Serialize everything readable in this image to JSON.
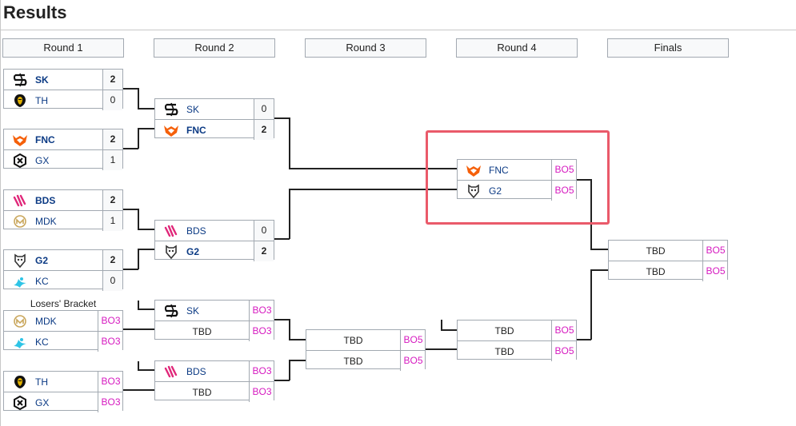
{
  "page": {
    "title": "Results"
  },
  "rounds": [
    "Round 1",
    "Round 2",
    "Round 3",
    "Round 4",
    "Finals"
  ],
  "losers_bracket_label": "Losers' Bracket",
  "colors": {
    "bo_text": "#d61ac0",
    "team_link": "#0b3a84",
    "highlight": "#ea5a6a",
    "header_bg": "#f8f9fa"
  },
  "matches": {
    "r1_m1": {
      "top": {
        "team": "SK",
        "logo": "sk-logo-icon",
        "score": "2",
        "win": true
      },
      "bottom": {
        "team": "TH",
        "logo": "th-logo-icon",
        "score": "0"
      }
    },
    "r1_m2": {
      "top": {
        "team": "FNC",
        "logo": "fnc-logo-icon",
        "score": "2",
        "win": true
      },
      "bottom": {
        "team": "GX",
        "logo": "gx-logo-icon",
        "score": "1"
      }
    },
    "r1_m3": {
      "top": {
        "team": "BDS",
        "logo": "bds-logo-icon",
        "score": "2",
        "win": true
      },
      "bottom": {
        "team": "MDK",
        "logo": "mdk-logo-icon",
        "score": "1"
      }
    },
    "r1_m4": {
      "top": {
        "team": "G2",
        "logo": "g2-logo-icon",
        "score": "2",
        "win": true
      },
      "bottom": {
        "team": "KC",
        "logo": "kc-logo-icon",
        "score": "0"
      }
    },
    "r1_m5": {
      "top": {
        "team": "MDK",
        "logo": "mdk-logo-icon",
        "score": "BO3"
      },
      "bottom": {
        "team": "KC",
        "logo": "kc-logo-icon",
        "score": "BO3"
      }
    },
    "r1_m6": {
      "top": {
        "team": "TH",
        "logo": "th-logo-icon",
        "score": "BO3"
      },
      "bottom": {
        "team": "GX",
        "logo": "gx-logo-icon",
        "score": "BO3"
      }
    },
    "r2_m1": {
      "top": {
        "team": "SK",
        "logo": "sk-logo-icon",
        "score": "0"
      },
      "bottom": {
        "team": "FNC",
        "logo": "fnc-logo-icon",
        "score": "2",
        "win": true
      }
    },
    "r2_m2": {
      "top": {
        "team": "BDS",
        "logo": "bds-logo-icon",
        "score": "0"
      },
      "bottom": {
        "team": "G2",
        "logo": "g2-logo-icon",
        "score": "2",
        "win": true
      }
    },
    "r2_m3": {
      "top": {
        "team": "SK",
        "logo": "sk-logo-icon",
        "score": "BO3"
      },
      "bottom": {
        "team": "TBD",
        "score": "BO3"
      }
    },
    "r2_m4": {
      "top": {
        "team": "BDS",
        "logo": "bds-logo-icon",
        "score": "BO3"
      },
      "bottom": {
        "team": "TBD",
        "score": "BO3"
      }
    },
    "r3_m1": {
      "top": {
        "team": "TBD",
        "score": "BO5"
      },
      "bottom": {
        "team": "TBD",
        "score": "BO5"
      }
    },
    "r4_m1": {
      "top": {
        "team": "FNC",
        "logo": "fnc-logo-icon",
        "score": "BO5"
      },
      "bottom": {
        "team": "G2",
        "logo": "g2-logo-icon",
        "score": "BO5"
      }
    },
    "r4_m2": {
      "top": {
        "team": "TBD",
        "score": "BO5"
      },
      "bottom": {
        "team": "TBD",
        "score": "BO5"
      }
    },
    "final": {
      "top": {
        "team": "TBD",
        "score": "BO5"
      },
      "bottom": {
        "team": "TBD",
        "score": "BO5"
      }
    }
  }
}
